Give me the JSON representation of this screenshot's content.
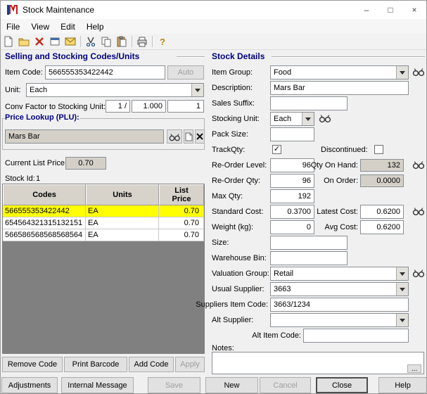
{
  "window": {
    "title": "Stock Maintenance",
    "menus": [
      "File",
      "View",
      "Edit",
      "Help"
    ]
  },
  "icons": {
    "minimize": "–",
    "maximize": "□",
    "close": "×",
    "help": "?",
    "more": "..."
  },
  "left": {
    "group_title": "Selling and Stocking Codes/Units",
    "item_code": {
      "label": "Item Code:",
      "value": "566555353422442",
      "auto_label": "Auto"
    },
    "unit": {
      "label": "Unit:",
      "value": "Each"
    },
    "conv": {
      "label": "Conv Factor to Stocking Unit:",
      "v1": "1 /",
      "v2": "1.000",
      "v3": "1"
    },
    "plu": {
      "title": "Price Lookup (PLU):",
      "value": "Mars Bar"
    },
    "current_list_price": {
      "label": "Current List Price:",
      "value": "0.70"
    },
    "stock_id": {
      "label": "Stock Id:",
      "value": "1"
    },
    "grid": {
      "headers": {
        "codes": "Codes",
        "units": "Units",
        "price": "List Price"
      },
      "rows": [
        {
          "code": "566555353422442",
          "unit": "EA",
          "price": "0.70"
        },
        {
          "code": "654564321315132151",
          "unit": "EA",
          "price": "0.70"
        },
        {
          "code": "566586568568568564",
          "unit": "EA",
          "price": "0.70"
        }
      ]
    },
    "buttons": {
      "remove": "Remove Code",
      "print": "Print Barcode",
      "add": "Add Code",
      "apply": "Apply"
    }
  },
  "right": {
    "group_title": "Stock Details",
    "item_group": {
      "label": "Item Group:",
      "value": "Food"
    },
    "description": {
      "label": "Description:",
      "value": "Mars Bar"
    },
    "sales_suffix": {
      "label": "Sales Suffix:",
      "value": ""
    },
    "stocking_unit": {
      "label": "Stocking Unit:",
      "value": "Each"
    },
    "pack_size": {
      "label": "Pack Size:",
      "value": ""
    },
    "track_qty": {
      "label": "TrackQty:",
      "mark": "✓"
    },
    "discontinued": {
      "label": "Discontinued:",
      "mark": ""
    },
    "reorder_level": {
      "label": "Re-Order Level:",
      "value": "96"
    },
    "qty_on_hand": {
      "label": "Qty On Hand:",
      "value": "132"
    },
    "reorder_qty": {
      "label": "Re-Order Qty:",
      "value": "96"
    },
    "on_order": {
      "label": "On Order:",
      "value": "0.0000"
    },
    "max_qty": {
      "label": "Max Qty:",
      "value": "192"
    },
    "standard_cost": {
      "label": "Standard Cost:",
      "value": "0.3700"
    },
    "latest_cost": {
      "label": "Latest Cost:",
      "value": "0.6200"
    },
    "weight": {
      "label": "Weight (kg):",
      "value": "0"
    },
    "avg_cost": {
      "label": "Avg Cost:",
      "value": "0.6200"
    },
    "size": {
      "label": "Size:",
      "value": ""
    },
    "warehouse_bin": {
      "label": "Warehouse Bin:",
      "value": ""
    },
    "valuation_group": {
      "label": "Valuation Group:",
      "value": "Retail"
    },
    "usual_supplier": {
      "label": "Usual Supplier:",
      "value": "3663"
    },
    "suppliers_item_code": {
      "label": "Suppliers Item Code:",
      "value": "3663/1234"
    },
    "alt_supplier": {
      "label": "Alt Supplier:",
      "value": ""
    },
    "alt_item_code": {
      "label": "Alt Item Code:",
      "value": ""
    },
    "notes": {
      "label": "Notes:",
      "value": ""
    }
  },
  "bottom": {
    "adjustments": "Adjustments",
    "internal_message": "Internal Message",
    "save": "Save",
    "new": "New",
    "cancel": "Cancel",
    "close": "Close",
    "help": "Help"
  }
}
